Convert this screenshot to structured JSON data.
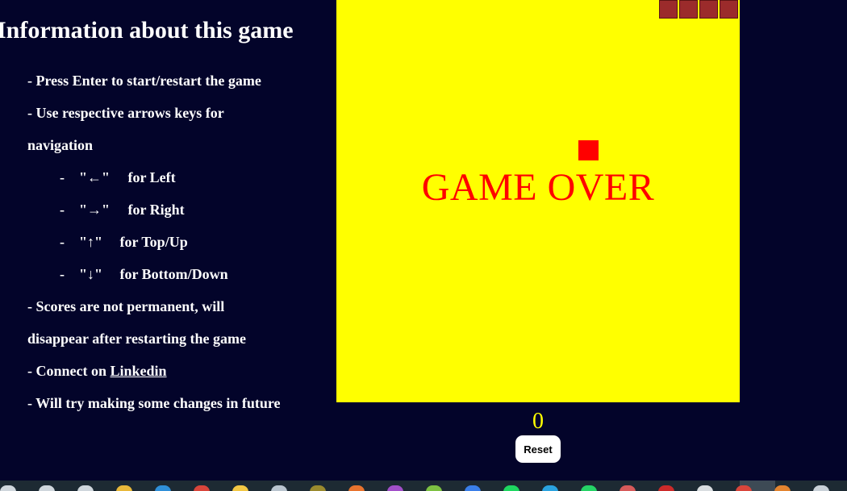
{
  "info": {
    "title": "Information about this game",
    "start_text": "- Press Enter to start/restart the game",
    "nav_text_1": "- Use respective arrows keys for",
    "nav_text_2": "navigation",
    "keys": [
      {
        "dash": "-",
        "key": "\"←\"",
        "desc": "for Left"
      },
      {
        "dash": "-",
        "key": "\"→\"",
        "desc": "for Right"
      },
      {
        "dash": "-",
        "key": "\"↑\"",
        "desc": "for Top/Up"
      },
      {
        "dash": "-",
        "key": "\"↓\"",
        "desc": "for Bottom/Down"
      }
    ],
    "scores_text_1": "- Scores are not permanent, will",
    "scores_text_2": "disappear after restarting the game",
    "connect_prefix": "- Connect on ",
    "connect_link": "Linkedin",
    "future_text": "- Will try making some changes in future"
  },
  "game": {
    "status_text": "GAME OVER",
    "score": "0",
    "reset_label": "Reset",
    "colors": {
      "background": "#03042a",
      "board": "#ffff00",
      "snake": "#9b2b2b",
      "food": "#ff0000",
      "game_over_text": "#ff0000",
      "score_text": "#ffff00"
    }
  },
  "taskbar": {
    "icons": [
      {
        "name": "windows-icon",
        "color": "#cfd6dc"
      },
      {
        "name": "search-icon",
        "color": "#cfd6dc"
      },
      {
        "name": "task-view-icon",
        "color": "#cfd6dc"
      },
      {
        "name": "file-explorer-icon",
        "color": "#e8b83a"
      },
      {
        "name": "vscode-icon",
        "color": "#2f8fd8"
      },
      {
        "name": "chrome-icon",
        "color": "#d9453b"
      },
      {
        "name": "paint-icon",
        "color": "#f2c744"
      },
      {
        "name": "notepad-icon",
        "color": "#b9c4ce"
      },
      {
        "name": "app-m-icon",
        "color": "#9a8a2e"
      },
      {
        "name": "orange-app-icon",
        "color": "#e8732e"
      },
      {
        "name": "purple-app-icon",
        "color": "#a24fc9"
      },
      {
        "name": "green-app-icon",
        "color": "#7dc142"
      },
      {
        "name": "blue-app-icon",
        "color": "#3a7ee8"
      },
      {
        "name": "spotify-icon",
        "color": "#1ed760"
      },
      {
        "name": "telegram-icon",
        "color": "#2aa3e0"
      },
      {
        "name": "whatsapp-icon",
        "color": "#25d366"
      },
      {
        "name": "pencil-icon",
        "color": "#d65a5a"
      },
      {
        "name": "red-app-icon",
        "color": "#cc2a2a"
      },
      {
        "name": "files-icon",
        "color": "#d9dde0"
      },
      {
        "name": "chrome-active-icon",
        "color": "#d9453b"
      },
      {
        "name": "orange-circle-icon",
        "color": "#e3842f"
      },
      {
        "name": "window-icon",
        "color": "#c9d1d8"
      }
    ]
  }
}
